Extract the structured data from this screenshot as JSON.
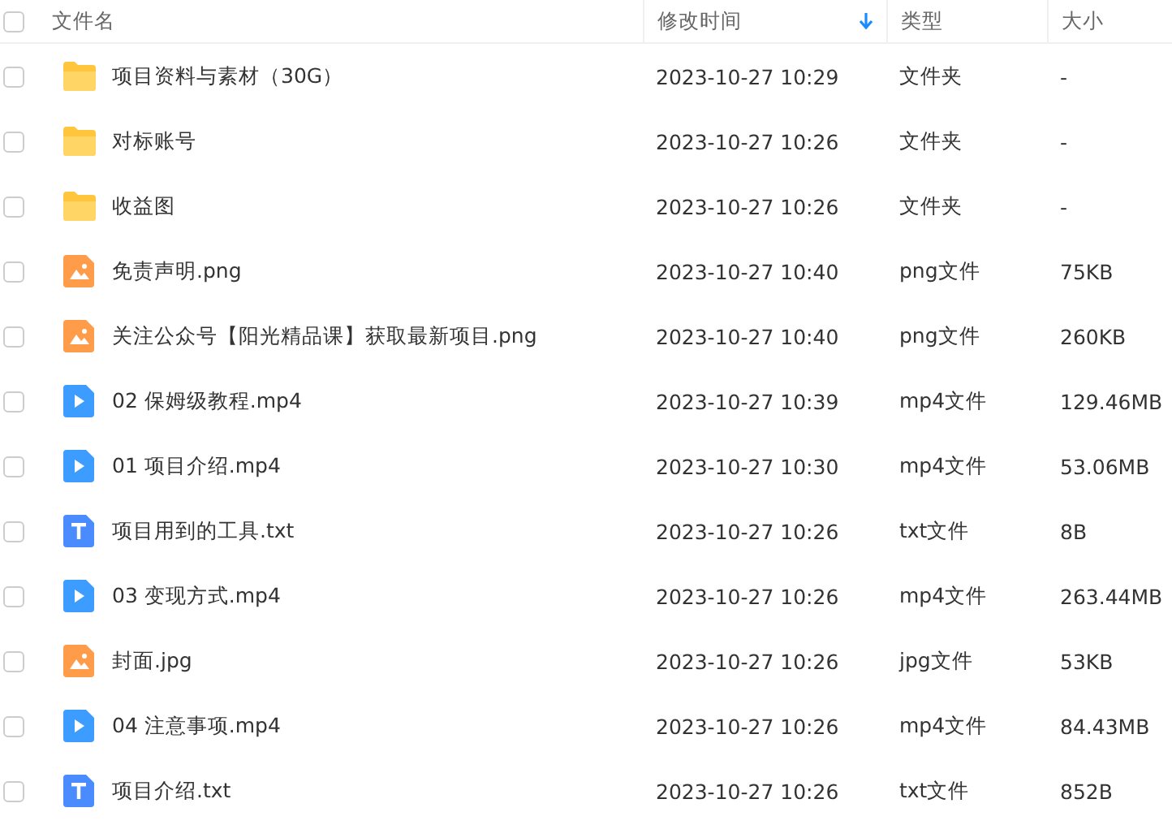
{
  "columns": [
    {
      "label": "文件名",
      "sorted": false
    },
    {
      "label": "修改时间",
      "sorted": true
    },
    {
      "label": "类型",
      "sorted": false
    },
    {
      "label": "大小",
      "sorted": false
    }
  ],
  "select_all": {
    "checked": false
  },
  "rows": [
    {
      "kind": "folder",
      "name": "项目资料与素材（30G）",
      "modified": "2023-10-27 10:29",
      "type": "文件夹",
      "size": "-",
      "checked": false
    },
    {
      "kind": "folder",
      "name": "对标账号",
      "modified": "2023-10-27 10:26",
      "type": "文件夹",
      "size": "-",
      "checked": false
    },
    {
      "kind": "folder",
      "name": "收益图",
      "modified": "2023-10-27 10:26",
      "type": "文件夹",
      "size": "-",
      "checked": false
    },
    {
      "kind": "image",
      "name": "免责声明.png",
      "modified": "2023-10-27 10:40",
      "type": "png文件",
      "size": "75KB",
      "checked": false
    },
    {
      "kind": "image",
      "name": "关注公众号【阳光精品课】获取最新项目.png",
      "modified": "2023-10-27 10:40",
      "type": "png文件",
      "size": "260KB",
      "checked": false
    },
    {
      "kind": "video",
      "name": "02 保姆级教程.mp4",
      "modified": "2023-10-27 10:39",
      "type": "mp4文件",
      "size": "129.46MB",
      "checked": false
    },
    {
      "kind": "video",
      "name": "01 项目介绍.mp4",
      "modified": "2023-10-27 10:30",
      "type": "mp4文件",
      "size": "53.06MB",
      "checked": false
    },
    {
      "kind": "text",
      "name": "项目用到的工具.txt",
      "modified": "2023-10-27 10:26",
      "type": "txt文件",
      "size": "8B",
      "checked": false
    },
    {
      "kind": "video",
      "name": "03 变现方式.mp4",
      "modified": "2023-10-27 10:26",
      "type": "mp4文件",
      "size": "263.44MB",
      "checked": false
    },
    {
      "kind": "image",
      "name": "封面.jpg",
      "modified": "2023-10-27 10:26",
      "type": "jpg文件",
      "size": "53KB",
      "checked": false
    },
    {
      "kind": "video",
      "name": "04 注意事项.mp4",
      "modified": "2023-10-27 10:26",
      "type": "mp4文件",
      "size": "84.43MB",
      "checked": false
    },
    {
      "kind": "text",
      "name": "项目介绍.txt",
      "modified": "2023-10-27 10:26",
      "type": "txt文件",
      "size": "852B",
      "checked": false
    }
  ]
}
